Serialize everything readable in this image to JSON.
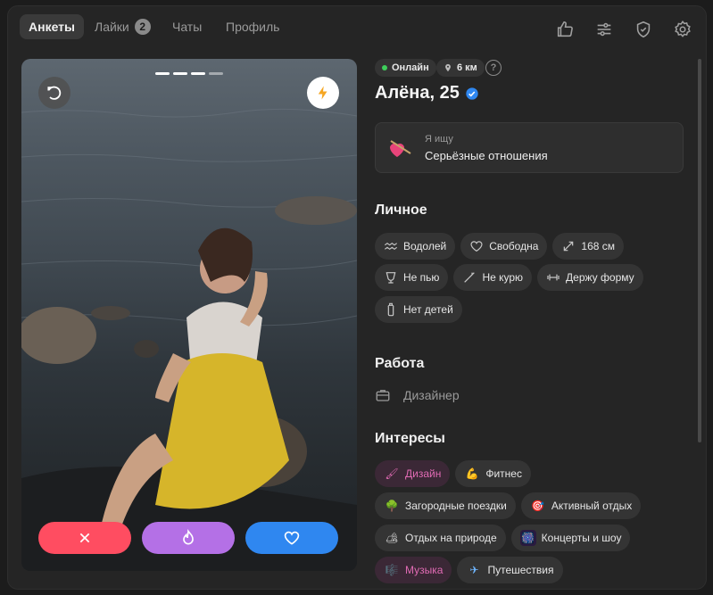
{
  "nav": {
    "tabs": [
      {
        "label": "Анкеты",
        "active": true
      },
      {
        "label": "Лайки",
        "badge": "2"
      },
      {
        "label": "Чаты"
      },
      {
        "label": "Профиль"
      }
    ],
    "icons": [
      "thumbs-up-icon",
      "sliders-icon",
      "shield-check-icon",
      "gear-icon"
    ]
  },
  "photo": {
    "progress_count": 4,
    "progress_active": 3,
    "left_button_icon": "undo-icon",
    "right_button_icon": "lightning-icon",
    "actions": [
      {
        "icon": "close-icon",
        "color": "#ff4d61"
      },
      {
        "icon": "flame-icon",
        "color": "#b470e6"
      },
      {
        "icon": "heart-icon",
        "color": "#2f87f0"
      }
    ]
  },
  "profile": {
    "online": "Онлайн",
    "distance": "6 км",
    "help": "?",
    "name_age": "Алёна, 25",
    "looking_for": {
      "label": "Я ищу",
      "value": "Серьёзные отношения"
    }
  },
  "personal": {
    "title": "Личное",
    "rows": [
      [
        {
          "icon": "aquarius-icon",
          "label": "Водолей"
        },
        {
          "icon": "heart-outline-icon",
          "label": "Свободна"
        },
        {
          "icon": "expand-icon",
          "label": "168 см"
        }
      ],
      [
        {
          "icon": "glass-icon",
          "label": "Не пью"
        },
        {
          "icon": "no-smoking-icon",
          "label": "Не курю"
        },
        {
          "icon": "dumbbell-icon",
          "label": "Держу форму"
        }
      ],
      [
        {
          "icon": "bottle-icon",
          "label": "Нет детей"
        }
      ]
    ]
  },
  "work": {
    "title": "Работа",
    "value": "Дизайнер",
    "icon": "briefcase-icon"
  },
  "interests": {
    "title": "Интересы",
    "rows": [
      [
        {
          "emoji": "🖌",
          "label": "Дизайн",
          "highlight": true
        },
        {
          "emoji": "💪",
          "label": "Фитнес"
        }
      ],
      [
        {
          "emoji": "🌳",
          "label": "Загородные поездки"
        },
        {
          "emoji": "🎯",
          "label": "Активный отдых"
        }
      ],
      [
        {
          "emoji": "🏕",
          "label": "Отдых на природе"
        },
        {
          "emoji": "🎆",
          "label": "Концерты и шоу"
        }
      ],
      [
        {
          "emoji": "🎼",
          "label": "Музыка",
          "highlight": true
        },
        {
          "emoji": "✈",
          "label": "Путешествия"
        }
      ]
    ]
  },
  "colors": {
    "accent_online": "#3ecf5b",
    "verified": "#2f87f0",
    "highlight_text": "#e16bb4"
  }
}
